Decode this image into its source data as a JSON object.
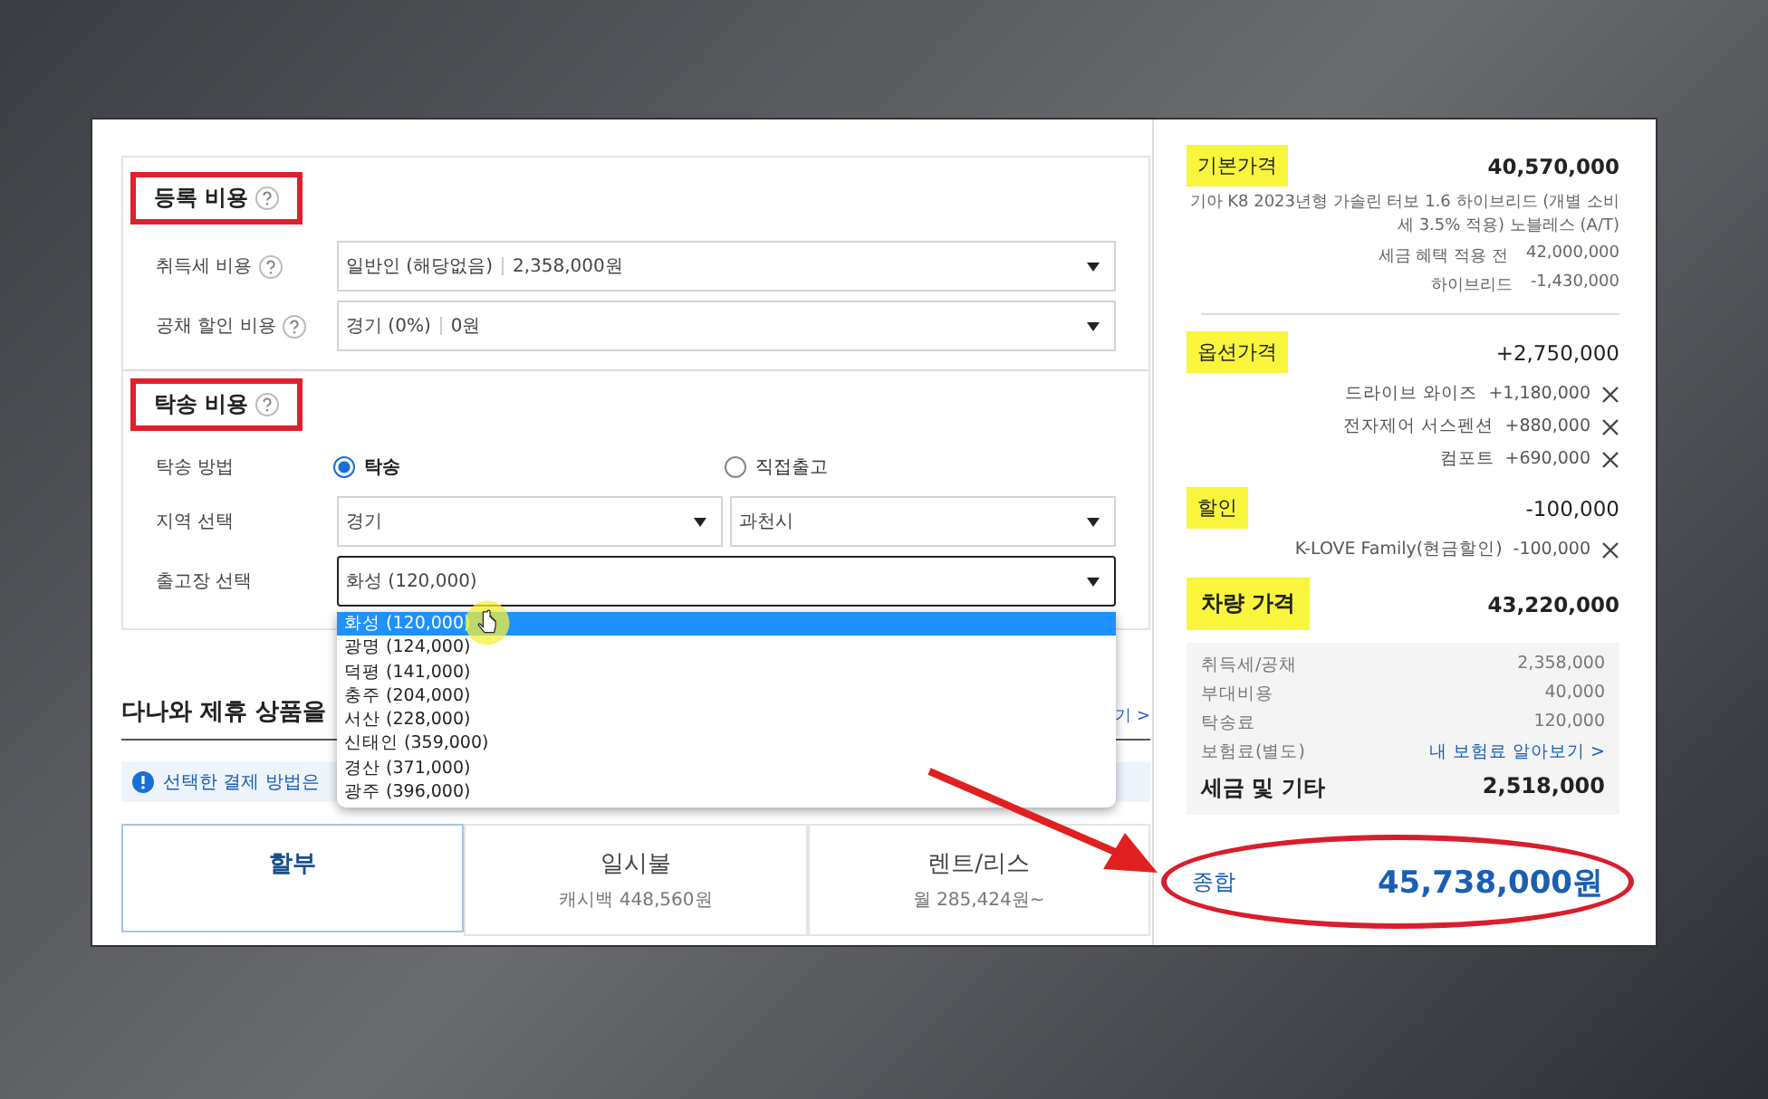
{
  "registration": {
    "title": "등록 비용",
    "fields": [
      {
        "label": "취득세 비용",
        "value": "일반인 (해당없음)",
        "amount": "2,358,000원"
      },
      {
        "label": "공채 할인 비용",
        "value": "경기 (0%)",
        "amount": "0원"
      }
    ]
  },
  "delivery": {
    "title": "탁송 비용",
    "method": {
      "label": "탁송 방법",
      "options": [
        {
          "label": "탁송",
          "selected": true
        },
        {
          "label": "직접출고",
          "selected": false
        }
      ]
    },
    "region": {
      "label": "지역 선택",
      "values": [
        "경기",
        "과천시"
      ]
    },
    "depot": {
      "label": "출고장 선택",
      "value": "화성 (120,000)",
      "expanded": true,
      "options": [
        {
          "label": "화성 (120,000)",
          "selected": true
        },
        {
          "label": "광명 (124,000)",
          "selected": false
        },
        {
          "label": "덕평 (141,000)",
          "selected": false
        },
        {
          "label": "충주 (204,000)",
          "selected": false
        },
        {
          "label": "서산 (228,000)",
          "selected": false
        },
        {
          "label": "신태인 (359,000)",
          "selected": false
        },
        {
          "label": "경산 (371,000)",
          "selected": false
        },
        {
          "label": "광주 (396,000)",
          "selected": false
        }
      ]
    }
  },
  "partner": {
    "heading": "다나와 제휴 상품을",
    "link": "기 >",
    "notice": "선택한 결제 방법은"
  },
  "payment_tabs": [
    {
      "title": "할부",
      "selected": true
    },
    {
      "title": "일시불",
      "subtitle": "캐시백 448,560원",
      "selected": false
    },
    {
      "title": "렌트/리스",
      "subtitle": "월 285,424원~",
      "selected": false
    }
  ],
  "summary": {
    "base": {
      "label": "기본가격",
      "amount": "40,570,000",
      "description": "기아 K8 2023년형 가솔린 터보 1.6 하이브리드 (개별 소비세 3.5% 적용) 노블레스 (A/T)",
      "details": [
        {
          "label": "세금 혜택 적용 전",
          "amount": "42,000,000"
        },
        {
          "label": "하이브리드",
          "amount": "-1,430,000"
        }
      ]
    },
    "options": {
      "label": "옵션가격",
      "amount": "+2,750,000",
      "items": [
        {
          "label": "드라이브 와이즈",
          "amount": "+1,180,000"
        },
        {
          "label": "전자제어 서스펜션",
          "amount": "+880,000"
        },
        {
          "label": "컴포트",
          "amount": "+690,000"
        }
      ]
    },
    "discount": {
      "label": "할인",
      "amount": "-100,000",
      "items": [
        {
          "label": "K-LOVE Family(현금할인)",
          "amount": "-100,000"
        }
      ]
    },
    "vehicle": {
      "label": "차량 가격",
      "amount": "43,220,000"
    },
    "taxes": {
      "rows": [
        {
          "label": "취득세/공채",
          "value": "2,358,000",
          "kind": "value"
        },
        {
          "label": "부대비용",
          "value": "40,000",
          "kind": "value"
        },
        {
          "label": "탁송료",
          "value": "120,000",
          "kind": "value"
        },
        {
          "label": "보험료(별도)",
          "value": "내 보험료 알아보기 >",
          "kind": "link"
        }
      ],
      "total_label": "세금 및 기타",
      "total": "2,518,000"
    },
    "grand_total": {
      "label": "종합",
      "amount": "45,738,000원"
    }
  }
}
